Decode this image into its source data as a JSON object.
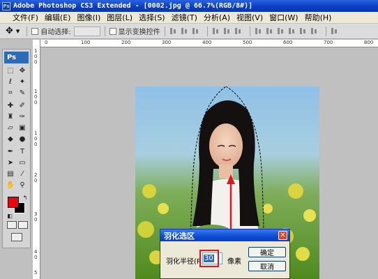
{
  "window": {
    "title": "Adobe Photoshop CS3 Extended - [0002.jpg @ 66.7%(RGB/8#)]",
    "app_icon": "Ps"
  },
  "menu": [
    "文件(F)",
    "编辑(E)",
    "图像(I)",
    "图层(L)",
    "选择(S)",
    "滤镜(T)",
    "分析(A)",
    "视图(V)",
    "窗口(W)",
    "帮助(H)"
  ],
  "options": {
    "auto_select": "自动选择:",
    "show_transform": "显示变换控件"
  },
  "rulers": {
    "top": [
      "0",
      "100",
      "200",
      "300",
      "400",
      "500",
      "600",
      "700",
      "800"
    ],
    "left": [
      "1",
      "0",
      "0",
      "1",
      "0",
      "0",
      "1",
      "0",
      "0",
      "2",
      "0",
      "3",
      "0",
      "4",
      "0",
      "5"
    ]
  },
  "toolbox": {
    "logo": "Ps"
  },
  "colors": {
    "foreground": "#e8070a",
    "background": "#000000",
    "annotation": "#e0161c"
  },
  "dialog": {
    "title": "羽化选区",
    "radius_label": "羽化半径(R):",
    "radius_value": "30",
    "unit": "像素",
    "ok": "确定",
    "cancel": "取消"
  }
}
